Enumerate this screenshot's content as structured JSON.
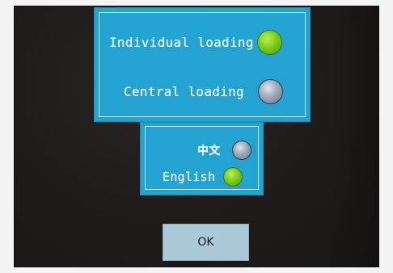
{
  "loading_mode": {
    "options": [
      {
        "label": "Individual loading",
        "selected": true
      },
      {
        "label": "Central loading",
        "selected": false
      }
    ]
  },
  "language": {
    "options": [
      {
        "label": "中文",
        "selected": false
      },
      {
        "label": "English",
        "selected": true
      }
    ]
  },
  "buttons": {
    "ok_label": "OK"
  },
  "colors": {
    "panel": "#22a3d2",
    "radio_selected": "#7ccc1c",
    "radio_unselected": "#9aa8b8",
    "ok_button": "#a9c8d8",
    "screen_background": "#1f1b1b"
  }
}
